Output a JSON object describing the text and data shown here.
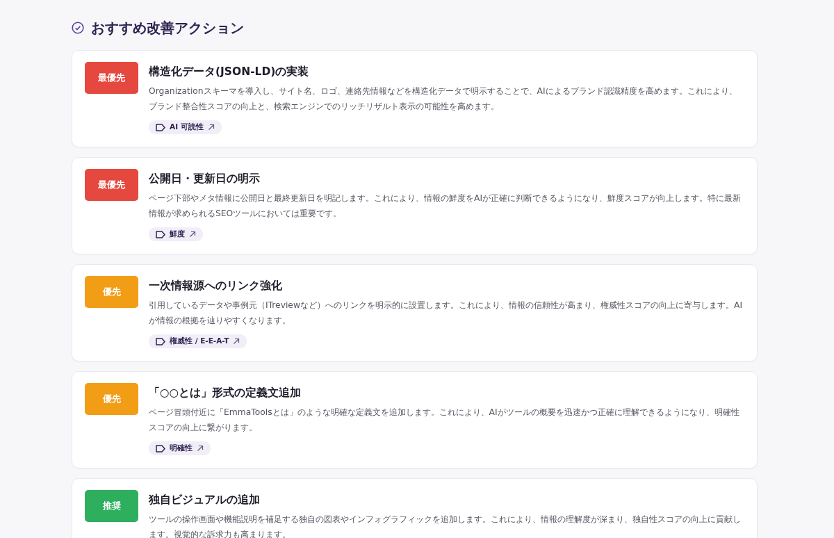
{
  "section": {
    "title": "おすすめ改善アクション"
  },
  "actions": [
    {
      "priority": "最優先",
      "kind": "highest",
      "title": "構造化データ(JSON-LD)の実装",
      "description": "Organizationスキーマを導入し、サイト名、ロゴ、連絡先情報などを構造化データで明示することで、AIによるブランド認識精度を高めます。これにより、ブランド整合性スコアの向上と、検索エンジンでのリッチリザルト表示の可能性を高めます。",
      "tag": "AI 可読性"
    },
    {
      "priority": "最優先",
      "kind": "highest",
      "title": "公開日・更新日の明示",
      "description": "ページ下部やメタ情報に公開日と最終更新日を明記します。これにより、情報の鮮度をAIが正確に判断できるようになり、鮮度スコアが向上します。特に最新情報が求められるSEOツールにおいては重要です。",
      "tag": "鮮度"
    },
    {
      "priority": "優先",
      "kind": "high",
      "title": "一次情報源へのリンク強化",
      "description": "引用しているデータや事例元（ITreviewなど）へのリンクを明示的に設置します。これにより、情報の信頼性が高まり、権威性スコアの向上に寄与します。AIが情報の根拠を辿りやすくなります。",
      "tag": "権威性 / E-E-A-T"
    },
    {
      "priority": "優先",
      "kind": "high",
      "title": "「○○とは」形式の定義文追加",
      "description": "ページ冒頭付近に「EmmaToolsとは」のような明確な定義文を追加します。これにより、AIがツールの概要を迅速かつ正確に理解できるようになり、明確性スコアの向上に繋がります。",
      "tag": "明確性"
    },
    {
      "priority": "推奨",
      "kind": "recommended",
      "title": "独自ビジュアルの追加",
      "description": "ツールの操作画面や機能説明を補足する独自の図表やインフォグラフィックを追加します。これにより、情報の理解度が深まり、独自性スコアの向上に貢献します。視覚的な訴求力も高まります。"
    }
  ]
}
